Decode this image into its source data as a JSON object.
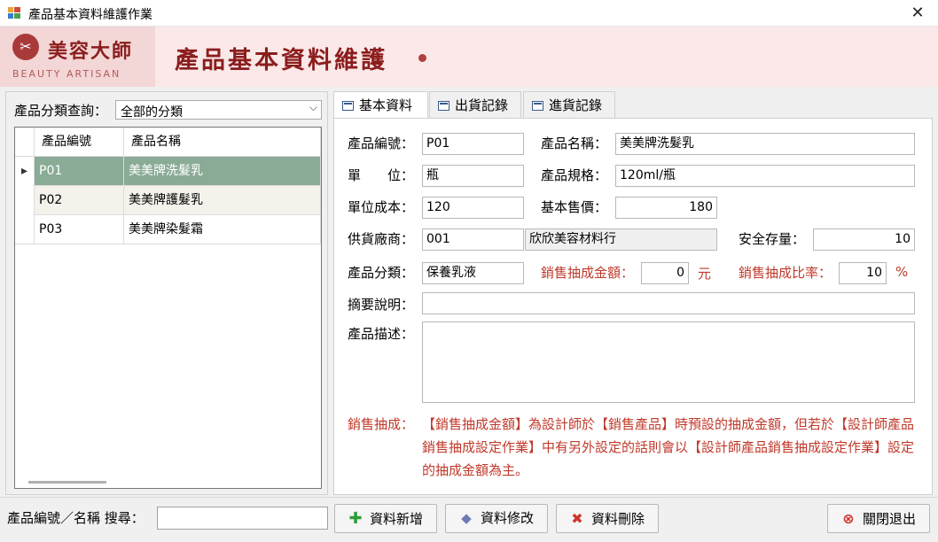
{
  "window": {
    "title": "產品基本資料維護作業",
    "close_glyph": "✕"
  },
  "banner": {
    "logo_glyph": "✂",
    "logo_text": "美容大師",
    "logo_sub": "BEAUTY ARTISAN",
    "title": "產品基本資料維護",
    "accent": "#8b1d1d"
  },
  "left": {
    "category_label": "產品分類查詢：",
    "category_value": "全部的分類",
    "grid": {
      "headers": [
        "產品編號",
        "產品名稱"
      ],
      "rows": [
        {
          "id": "P01",
          "name": "美美牌洗髮乳",
          "selected": true
        },
        {
          "id": "P02",
          "name": "美美牌護髮乳",
          "selected": false
        },
        {
          "id": "P03",
          "name": "美美牌染髮霜",
          "selected": false
        }
      ],
      "selected_color": "#8aab96"
    }
  },
  "tabs": [
    {
      "label": "基本資料",
      "active": true
    },
    {
      "label": "出貨記錄",
      "active": false
    },
    {
      "label": "進貨記錄",
      "active": false
    }
  ],
  "form": {
    "product_id_label": "產品編號：",
    "product_id": "P01",
    "product_name_label": "產品名稱：",
    "product_name": "美美牌洗髮乳",
    "unit_label": "單　　位：",
    "unit": "瓶",
    "spec_label": "產品規格：",
    "spec": "120ml/瓶",
    "cost_label": "單位成本：",
    "cost": "120",
    "price_label": "基本售價：",
    "price": "180",
    "supplier_label": "供貨廠商：",
    "supplier_id": "001",
    "supplier_name": "欣欣美容材料行",
    "safety_stock_label": "安全存量：",
    "safety_stock": "10",
    "category_label": "產品分類：",
    "category": "保養乳液",
    "commission_amount_label": "銷售抽成金額：",
    "commission_amount": "0",
    "commission_amount_unit": "元",
    "commission_rate_label": "銷售抽成比率：",
    "commission_rate": "10",
    "commission_rate_unit": "%",
    "summary_label": "摘要說明：",
    "summary": "",
    "description_label": "產品描述：",
    "description": "",
    "note_label": "銷售抽成：",
    "note_text": "【銷售抽成金額】為設計師於【銷售產品】時預設的抽成金額，但若於【設計師產品銷售抽成設定作業】中有另外設定的話則會以【設計師產品銷售抽成設定作業】設定的抽成金額為主。"
  },
  "bottom": {
    "search_label": "產品編號／名稱 搜尋：",
    "search_value": "",
    "add_label": "資料新增",
    "edit_label": "資料修改",
    "delete_label": "資料刪除",
    "exit_label": "關閉退出"
  }
}
